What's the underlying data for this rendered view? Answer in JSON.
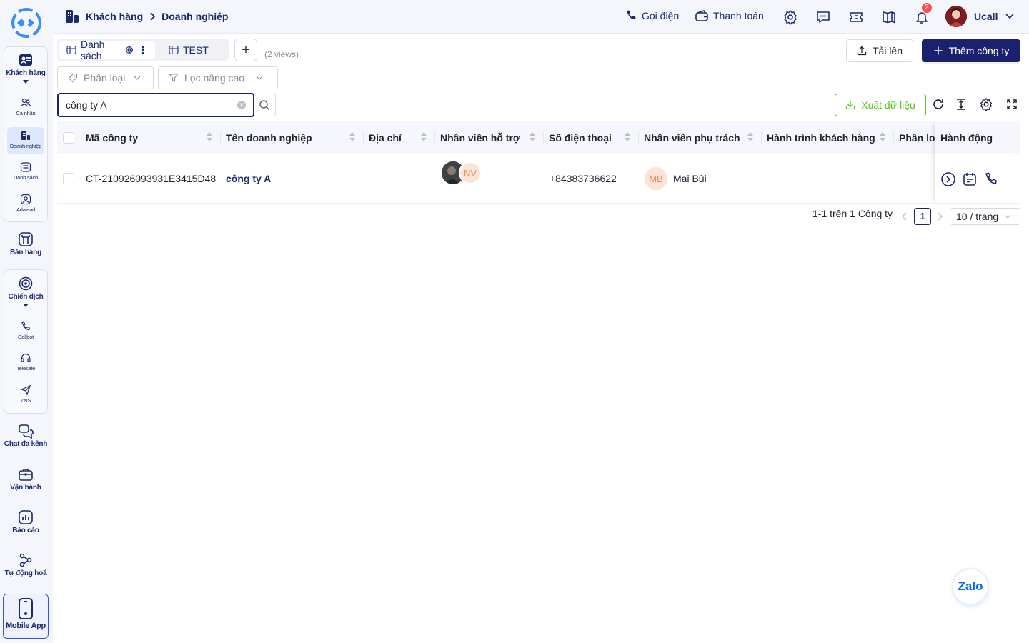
{
  "sidebar": {
    "groups": [
      {
        "label": "Khách hàng",
        "icon": "customer-card-icon",
        "subitems": [
          {
            "label": "Cá nhân",
            "icon": "users-icon",
            "active": false
          },
          {
            "label": "Doanh nghiệp",
            "icon": "business-icon",
            "active": true
          },
          {
            "label": "Danh sách",
            "icon": "list-icon",
            "active": false
          },
          {
            "label": "Adalead",
            "icon": "adalead-icon",
            "active": false
          }
        ]
      },
      {
        "label": "Bán hàng",
        "icon": "store-icon"
      },
      {
        "label": "Chiến dịch",
        "icon": "target-icon",
        "subitems": [
          {
            "label": "Callbot",
            "icon": "phone-icon"
          },
          {
            "label": "Telesale",
            "icon": "headset-icon"
          },
          {
            "label": "ZNS",
            "icon": "send-icon"
          }
        ]
      },
      {
        "label": "Chat đa kênh",
        "icon": "chat-icon"
      },
      {
        "label": "Vận hành",
        "icon": "briefcase-icon"
      },
      {
        "label": "Báo cáo",
        "icon": "report-icon"
      },
      {
        "label": "Tự động hoá",
        "icon": "automation-icon"
      }
    ],
    "mobile_app": "Mobile App"
  },
  "header": {
    "breadcrumb": [
      "Khách hàng",
      "Doanh nghiệp"
    ],
    "call_label": "Gọi điện",
    "payment_label": "Thanh toán",
    "notification_count": "2",
    "user_name": "Ucall"
  },
  "views": {
    "tabs": [
      {
        "label": "Danh sách",
        "active": true
      },
      {
        "label": "TEST",
        "active": false
      }
    ],
    "add_label": "+",
    "count_label": "(2 views)"
  },
  "actions": {
    "upload_label": "Tải lên",
    "add_company_label": "Thêm công ty",
    "export_label": "Xuất dữ liệu"
  },
  "filters": {
    "category_placeholder": "Phân loại",
    "advanced_placeholder": "Lọc nâng cao"
  },
  "search": {
    "value": "công ty A"
  },
  "table": {
    "columns": [
      "Mã công ty",
      "Tên doanh nghiệp",
      "Địa chỉ",
      "Nhân viên hỗ trợ",
      "Số điện thoại",
      "Nhân viên phụ trách",
      "Hành trình khách hàng",
      "Phân loại",
      "Hành động"
    ],
    "rows": [
      {
        "code": "CT-210926093931E3415D48",
        "name": "công ty A",
        "address": "",
        "support_initials": "NV",
        "phone": "+84383736622",
        "owner_initials": "MB",
        "owner_name": "Mai Bùi",
        "journey": "",
        "category": ""
      }
    ]
  },
  "pagination": {
    "summary": "1-1 trên 1 Công ty",
    "current_page": "1",
    "page_size": "10 / trang"
  },
  "zalo_label": "Zalo",
  "colors": {
    "primary": "#1a2270",
    "nav_text": "#1a2a6c",
    "export_green": "#52c41a",
    "badge_red": "#ff4d4f",
    "avatar_bg": "#fde3d6",
    "avatar_text": "#f08a5d"
  }
}
